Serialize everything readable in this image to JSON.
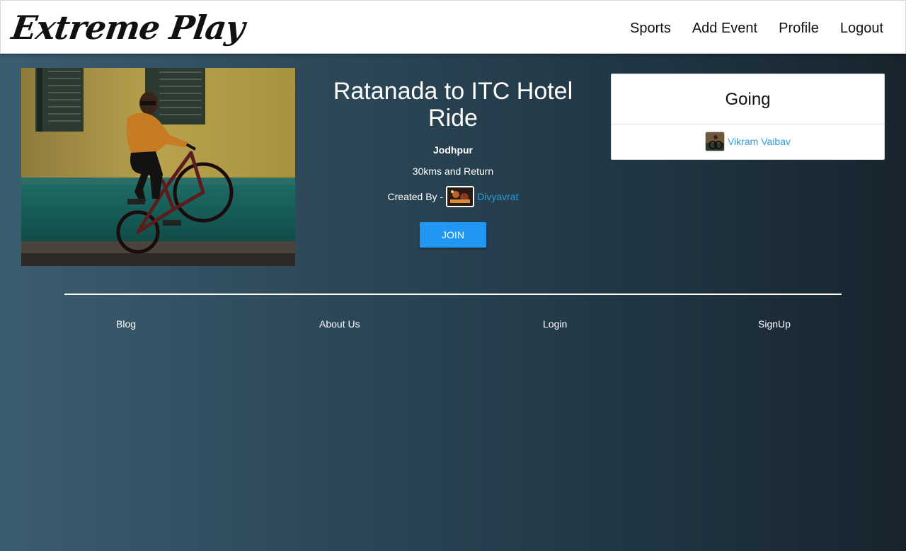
{
  "brand": "Extreme Play",
  "nav": {
    "items": [
      "Sports",
      "Add Event",
      "Profile",
      "Logout"
    ]
  },
  "event": {
    "title": "Ratanada to ITC Hotel Ride",
    "location": "Jodhpur",
    "description": "30kms and Return",
    "created_by_label": "Created By -",
    "creator_name": "Divyavrat",
    "join_label": "JOIN"
  },
  "going": {
    "title": "Going",
    "attendees": [
      {
        "name": "Vikram Vaibav"
      }
    ]
  },
  "footer": {
    "links": [
      "Blog",
      "About Us",
      "Login",
      "SignUp"
    ]
  },
  "colors": {
    "accent": "#2196f3",
    "link": "#2b9ddb",
    "background_dark": "#17242d",
    "background_light": "#3b5d70"
  },
  "icons": {
    "event_photo": "bmx-rider-wheelie-photo",
    "creator_avatar": "creator-avatar-photo",
    "attendee_avatar": "attendee-avatar-photo"
  }
}
